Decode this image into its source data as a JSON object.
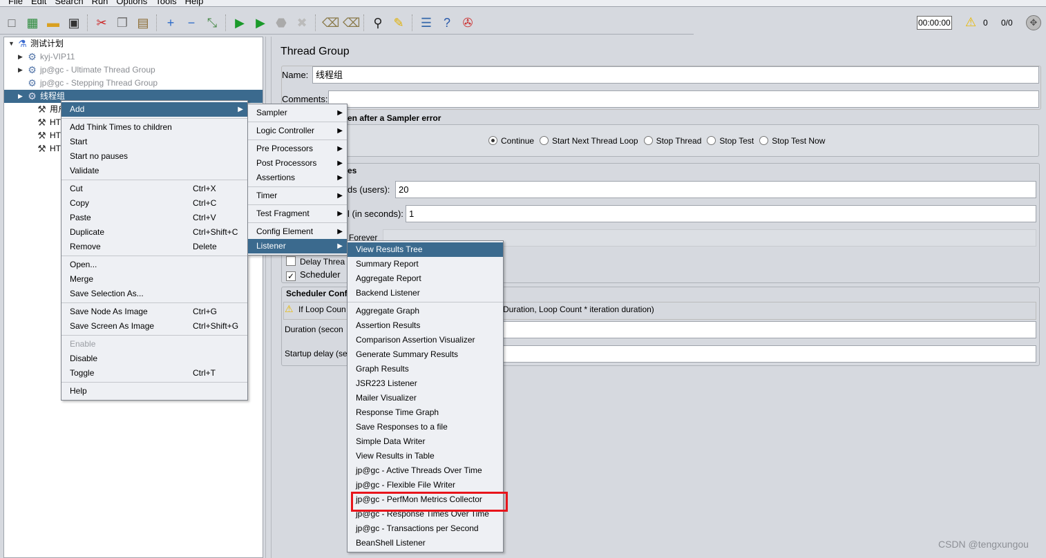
{
  "menubar": [
    "File",
    "Edit",
    "Search",
    "Run",
    "Options",
    "Tools",
    "Help"
  ],
  "toolbar": {
    "icons": [
      "new-icon",
      "templates-icon",
      "open-icon",
      "save-icon",
      "cut-icon",
      "copy-icon",
      "paste-icon",
      "expand-icon",
      "collapse-icon",
      "toggle-icon",
      "start-icon",
      "start-no-pauses-icon",
      "stop-icon",
      "shutdown-icon",
      "clear-icon",
      "clear-all-icon",
      "search-icon",
      "reset-search-icon",
      "function-helper-icon",
      "help-icon",
      "remote-icon"
    ],
    "timer": "00:00:00",
    "warning_count": "0",
    "threads": "0/0"
  },
  "tree": {
    "items": [
      {
        "label": "测试计划",
        "icon": "test-plan-icon",
        "expanded": true,
        "disabled": false
      },
      {
        "label": "kyj-VIP11",
        "icon": "gear-icon",
        "disabled": true
      },
      {
        "label": "jp@gc - Ultimate Thread Group",
        "icon": "gear-icon",
        "disabled": true
      },
      {
        "label": "jp@gc - Stepping Thread Group",
        "icon": "gear-icon",
        "disabled": true
      },
      {
        "label": "线程组",
        "icon": "gear-icon",
        "selected": true
      },
      {
        "label": "用户定",
        "icon": "sampler-icon"
      },
      {
        "label": "HTTP",
        "icon": "sampler-icon"
      },
      {
        "label": "HTTP",
        "icon": "sampler-icon"
      },
      {
        "label": "HTTP",
        "icon": "sampler-icon"
      }
    ]
  },
  "panel": {
    "title": "Thread Group",
    "name_label": "Name:",
    "name_value": "线程组",
    "comments_label": "Comments:",
    "comments_value": "",
    "error_section": "en after a Sampler error",
    "error_actions": [
      "Continue",
      "Start Next Thread Loop",
      "Stop Thread",
      "Stop Test",
      "Stop Test Now"
    ],
    "error_selected": "Continue",
    "props_section": "es",
    "users_label": "ds (users):",
    "users_value": "20",
    "ramp_label": "l (in seconds):",
    "ramp_value": "1",
    "forever_label": "Forever",
    "delay_label": "Delay Threa",
    "delay_checked": false,
    "scheduler_label": "Scheduler",
    "scheduler_checked": true,
    "sched_section": "Scheduler Confi",
    "warn_left": "If Loop Coun",
    "warn_right": "Duration, Loop Count * iteration duration)",
    "duration_label": "Duration (secon",
    "duration_value": "",
    "startup_label": "Startup delay (se",
    "startup_value": ""
  },
  "context_menu": {
    "groups": [
      [
        {
          "label": "Add",
          "submenu": true,
          "highlighted": true
        }
      ],
      [
        {
          "label": "Add Think Times to children"
        },
        {
          "label": "Start"
        },
        {
          "label": "Start no pauses"
        },
        {
          "label": "Validate"
        }
      ],
      [
        {
          "label": "Cut",
          "shortcut": "Ctrl+X"
        },
        {
          "label": "Copy",
          "shortcut": "Ctrl+C"
        },
        {
          "label": "Paste",
          "shortcut": "Ctrl+V"
        },
        {
          "label": "Duplicate",
          "shortcut": "Ctrl+Shift+C"
        },
        {
          "label": "Remove",
          "shortcut": "Delete"
        }
      ],
      [
        {
          "label": "Open..."
        },
        {
          "label": "Merge"
        },
        {
          "label": "Save Selection As..."
        }
      ],
      [
        {
          "label": "Save Node As Image",
          "shortcut": "Ctrl+G"
        },
        {
          "label": "Save Screen As Image",
          "shortcut": "Ctrl+Shift+G"
        }
      ],
      [
        {
          "label": "Enable",
          "disabled": true
        },
        {
          "label": "Disable"
        },
        {
          "label": "Toggle",
          "shortcut": "Ctrl+T"
        }
      ],
      [
        {
          "label": "Help"
        }
      ]
    ]
  },
  "add_menu": {
    "groups": [
      [
        {
          "label": "Sampler",
          "submenu": true
        }
      ],
      [
        {
          "label": "Logic Controller",
          "submenu": true
        }
      ],
      [
        {
          "label": "Pre Processors",
          "submenu": true
        },
        {
          "label": "Post Processors",
          "submenu": true
        },
        {
          "label": "Assertions",
          "submenu": true
        }
      ],
      [
        {
          "label": "Timer",
          "submenu": true
        }
      ],
      [
        {
          "label": "Test Fragment",
          "submenu": true
        }
      ],
      [
        {
          "label": "Config Element",
          "submenu": true
        },
        {
          "label": "Listener",
          "submenu": true,
          "highlighted": true
        }
      ]
    ]
  },
  "listener_menu": {
    "groups": [
      [
        {
          "label": "View Results Tree",
          "highlighted": true
        },
        {
          "label": "Summary Report"
        },
        {
          "label": "Aggregate Report"
        },
        {
          "label": "Backend Listener"
        }
      ],
      [
        {
          "label": "Aggregate Graph"
        },
        {
          "label": "Assertion Results"
        },
        {
          "label": "Comparison Assertion Visualizer"
        },
        {
          "label": "Generate Summary Results"
        },
        {
          "label": "Graph Results"
        },
        {
          "label": "JSR223 Listener"
        },
        {
          "label": "Mailer Visualizer"
        },
        {
          "label": "Response Time Graph"
        },
        {
          "label": "Save Responses to a file"
        },
        {
          "label": "Simple Data Writer"
        },
        {
          "label": "View Results in Table"
        },
        {
          "label": "jp@gc - Active Threads Over Time"
        },
        {
          "label": "jp@gc - Flexible File Writer"
        },
        {
          "label": "jp@gc - PerfMon Metrics Collector",
          "annotated": true
        },
        {
          "label": "jp@gc - Response Times Over Time"
        },
        {
          "label": "jp@gc - Transactions per Second"
        },
        {
          "label": "BeanShell Listener"
        }
      ]
    ]
  },
  "colors": {
    "selection": "#3b6a8e",
    "annotation": "#e8141b",
    "panel_bg": "#d6d9df"
  },
  "watermark": "CSDN @tengxungou"
}
